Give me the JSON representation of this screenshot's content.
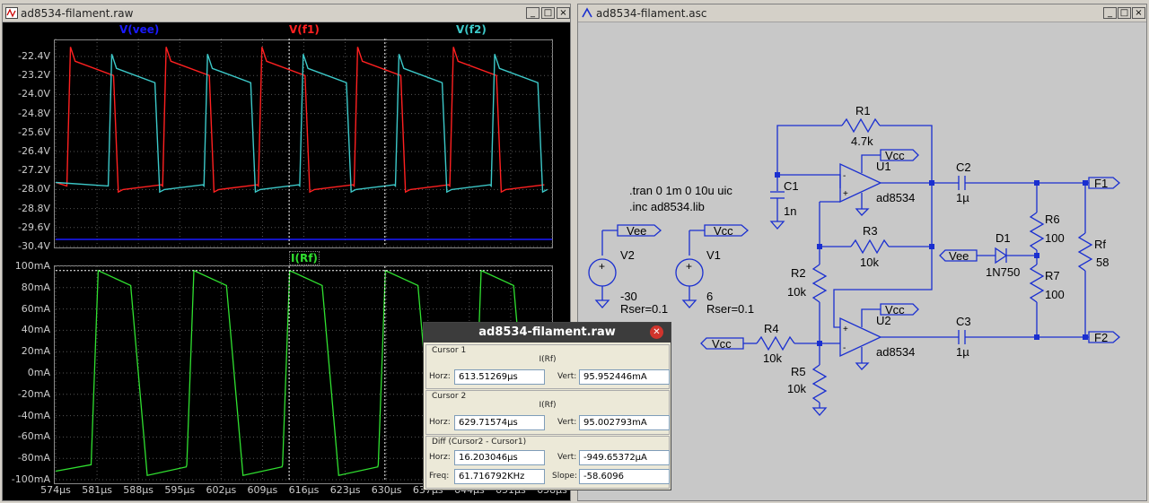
{
  "waveform_window": {
    "title": "ad8534-filament.raw",
    "top_pane": {
      "traces": [
        {
          "name": "V(vee)",
          "color": "#1a1aff"
        },
        {
          "name": "V(f1)",
          "color": "#ff2020"
        },
        {
          "name": "V(f2)",
          "color": "#3cc8c8"
        }
      ],
      "y_ticks": [
        "-22.4V",
        "-23.2V",
        "-24.0V",
        "-24.8V",
        "-25.6V",
        "-26.4V",
        "-27.2V",
        "-28.0V",
        "-28.8V",
        "-29.6V",
        "-30.4V"
      ]
    },
    "bottom_pane": {
      "traces": [
        {
          "name": "I(Rf)",
          "color": "#30e030"
        }
      ],
      "y_ticks": [
        "100mA",
        "80mA",
        "60mA",
        "40mA",
        "20mA",
        "0mA",
        "-20mA",
        "-40mA",
        "-60mA",
        "-80mA",
        "-100mA"
      ]
    },
    "x_ticks": [
      "574µs",
      "581µs",
      "588µs",
      "595µs",
      "602µs",
      "609µs",
      "616µs",
      "623µs",
      "630µs",
      "637µs",
      "644µs",
      "651µs",
      "658µs"
    ]
  },
  "chart_data": [
    {
      "type": "line",
      "xlim": [
        574,
        658
      ],
      "ylim": [
        -30.4,
        -22.4
      ],
      "yticks": [
        "-22.4V",
        "-23.2V",
        "-24.0V",
        "-24.8V",
        "-25.6V",
        "-26.4V",
        "-27.2V",
        "-28.0V",
        "-28.8V",
        "-29.6V",
        "-30.4V"
      ],
      "period_us": 16.2,
      "series": [
        {
          "name": "V(vee)",
          "constant": -30.1
        },
        {
          "name": "V(f1)",
          "high": -22.6,
          "low": -28.0,
          "rise_us": [
            576.5,
            592.7,
            608.9,
            625.1,
            641.3
          ]
        },
        {
          "name": "V(f2)",
          "high": -22.9,
          "low": -28.0,
          "rise_us": [
            583.5,
            599.7,
            615.9,
            632.1,
            648.3
          ]
        }
      ]
    },
    {
      "type": "line",
      "xlim": [
        574,
        658
      ],
      "ylim": [
        -100,
        100
      ],
      "yticks": [
        "100mA",
        "80mA",
        "60mA",
        "40mA",
        "20mA",
        "0mA",
        "-20mA",
        "-40mA",
        "-60mA",
        "-80mA",
        "-100mA"
      ],
      "series": [
        {
          "name": "I(Rf)",
          "peaks_us": [
            581.2,
            597.4,
            613.6,
            629.8,
            646.0
          ],
          "troughs_us": [
            589.5,
            605.7,
            621.9,
            638.1,
            654.3
          ],
          "max": 96,
          "min": -96
        }
      ]
    }
  ],
  "cursors": {
    "cursor1_x_us": 613.51,
    "cursor2_x_us": 629.72
  },
  "cursor_dialog": {
    "title": "ad8534-filament.raw",
    "cursor1": {
      "label": "Cursor 1",
      "trace": "I(Rf)",
      "horz_label": "Horz:",
      "horz": "613.51269µs",
      "vert_label": "Vert:",
      "vert": "95.952446mA"
    },
    "cursor2": {
      "label": "Cursor 2",
      "trace": "I(Rf)",
      "horz_label": "Horz:",
      "horz": "629.71574µs",
      "vert_label": "Vert:",
      "vert": "95.002793mA"
    },
    "diff": {
      "label": "Diff (Cursor2 - Cursor1)",
      "horz_label": "Horz:",
      "horz": "16.203046µs",
      "vert_label": "Vert:",
      "vert": "-949.65372µA",
      "freq_label": "Freq:",
      "freq": "61.716792KHz",
      "slope_label": "Slope:",
      "slope": "-58.6096"
    }
  },
  "schematic_window": {
    "title": "ad8534-filament.asc",
    "directives": [
      ".tran 0 1m 0 10u uic",
      ".inc ad8534.lib"
    ],
    "labels": {
      "R1": "R1",
      "R1_val": "4.7k",
      "R2": "R2",
      "R2_val": "10k",
      "R3": "R3",
      "R3_val": "10k",
      "R4": "R4",
      "R4_val": "10k",
      "R5": "R5",
      "R5_val": "10k",
      "R6": "R6",
      "R6_val": "100",
      "R7": "R7",
      "R7_val": "100",
      "Rf": "Rf",
      "Rf_val": "58",
      "C1": "C1",
      "C1_val": "1n",
      "C2": "C2",
      "C2_val": "1µ",
      "C3": "C3",
      "C3_val": "1µ",
      "D1": "D1",
      "D1_val": "1N750",
      "U1": "U1",
      "U1_val": "ad8534",
      "U2": "U2",
      "U2_val": "ad8534",
      "V1": "V1",
      "V1_val": "6",
      "V1_rser": "Rser=0.1",
      "V2": "V2",
      "V2_val": "-30",
      "V2_rser": "Rser=0.1",
      "vee1": "Vee",
      "vcc1": "Vcc",
      "vcc_u1": "Vcc",
      "vcc_u2": "Vcc",
      "vee_d1": "Vee",
      "vcc_r4": "Vcc",
      "f1": "F1",
      "f2": "F2"
    }
  },
  "colors": {
    "schematic_wire": "#1a2fd0",
    "schematic_bg": "#c8c8c8",
    "plot_bg": "#000000"
  }
}
